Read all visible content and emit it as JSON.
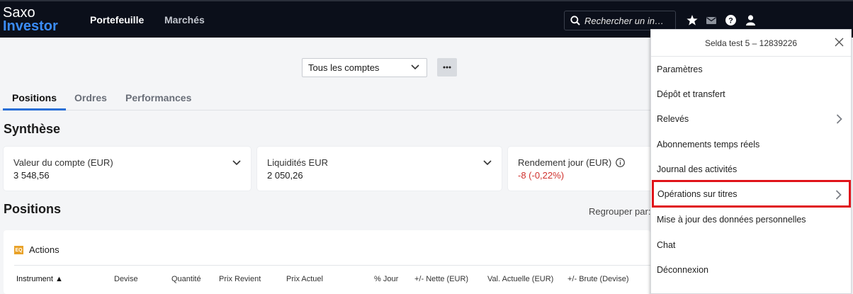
{
  "brand": {
    "line1": "Saxo",
    "line2": "Investor"
  },
  "nav": {
    "portfolio": "Portefeuille",
    "markets": "Marchés"
  },
  "search": {
    "placeholder": "Rechercher un in…"
  },
  "account_select": {
    "value": "Tous les comptes"
  },
  "tabs": [
    {
      "label": "Positions"
    },
    {
      "label": "Ordres"
    },
    {
      "label": "Performances"
    }
  ],
  "summary": {
    "title": "Synthèse",
    "cards": [
      {
        "label": "Valeur du compte (EUR)",
        "value": "3 548,56"
      },
      {
        "label": "Liquidités EUR",
        "value": "2 050,26"
      },
      {
        "label": "Rendement jour (EUR)",
        "value": "-8 (-0,22%)"
      }
    ]
  },
  "positions": {
    "title": "Positions",
    "group_by": "Regrouper par:",
    "group_badge": "EQ",
    "group_label": "Actions",
    "columns": [
      "Instrument ▲",
      "Devise",
      "Quantité",
      "Prix Revient",
      "Prix Actuel",
      "% Jour",
      "+/- Nette (EUR)",
      "Val. Actuelle (EUR)",
      "+/- Brute (Devise)"
    ]
  },
  "menu": {
    "header": "Selda test 5 – 12839226",
    "items": [
      {
        "label": "Paramètres"
      },
      {
        "label": "Dépôt et transfert"
      },
      {
        "label": "Relevés"
      },
      {
        "label": "Abonnements temps réels"
      },
      {
        "label": "Journal des activités"
      },
      {
        "label": "Opérations sur titres"
      },
      {
        "label": "Mise à jour des données personnelles"
      },
      {
        "label": "Chat"
      },
      {
        "label": "Déconnexion"
      }
    ]
  },
  "colors": {
    "nav_bg": "#0b0f1a",
    "brand_blue": "#3b8cf6",
    "highlight": "#e0141a",
    "negative": "#d0312d",
    "tab_accent": "#2a6fd6"
  }
}
